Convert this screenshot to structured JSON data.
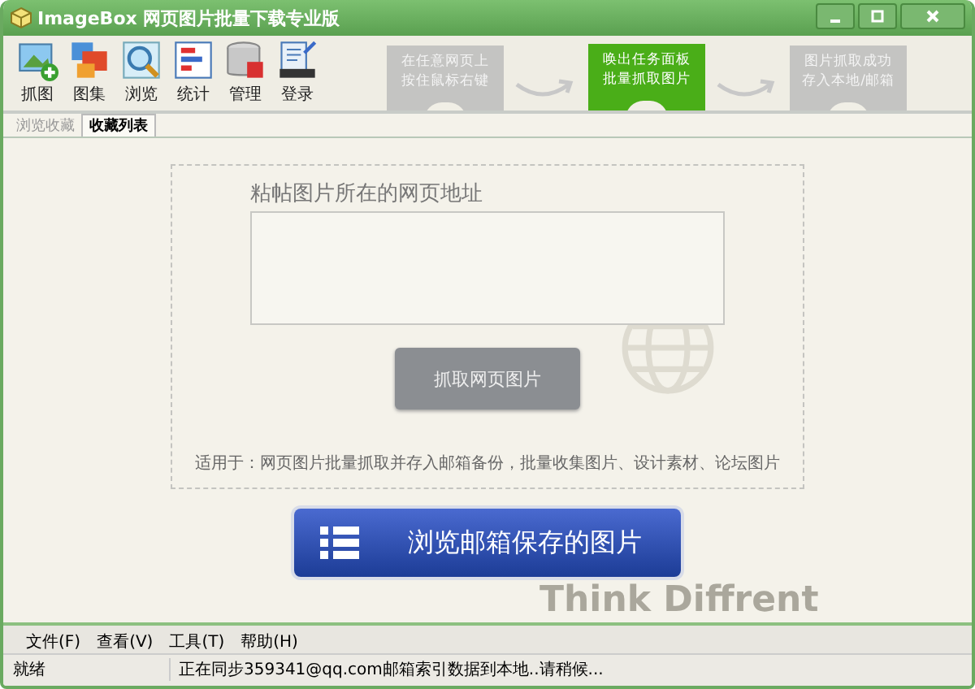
{
  "window": {
    "title": "ImageBox 网页图片批量下载专业版"
  },
  "toolbar": [
    {
      "label": "抓图",
      "kind": "grab"
    },
    {
      "label": "图集",
      "kind": "album"
    },
    {
      "label": "浏览",
      "kind": "browse"
    },
    {
      "label": "统计",
      "kind": "stats"
    },
    {
      "label": "管理",
      "kind": "db"
    },
    {
      "label": "登录",
      "kind": "login"
    }
  ],
  "steps": [
    {
      "text": "在任意网页上按住鼠标右键",
      "selected": false
    },
    {
      "text": "唤出任务面板批量抓取图片",
      "selected": true
    },
    {
      "text": "图片抓取成功存入本地/邮箱",
      "selected": false
    }
  ],
  "tabs": [
    {
      "label": "浏览收藏",
      "selected": false
    },
    {
      "label": "收藏列表",
      "selected": true
    }
  ],
  "url_panel": {
    "label": "粘帖图片所在的网页地址",
    "button": "抓取网页图片",
    "note": "适用于：网页图片批量抓取并存入邮箱备份，批量收集图片、设计素材、论坛图片"
  },
  "mailbox_button": "浏览邮箱保存的图片",
  "slogan": "Think Diffrent",
  "menu": [
    "文件(F)",
    "查看(V)",
    "工具(T)",
    "帮助(H)"
  ],
  "status_bar": [
    "就绪",
    "正在同步359341@qq.com邮箱索引数据到本地..请稍候..."
  ]
}
